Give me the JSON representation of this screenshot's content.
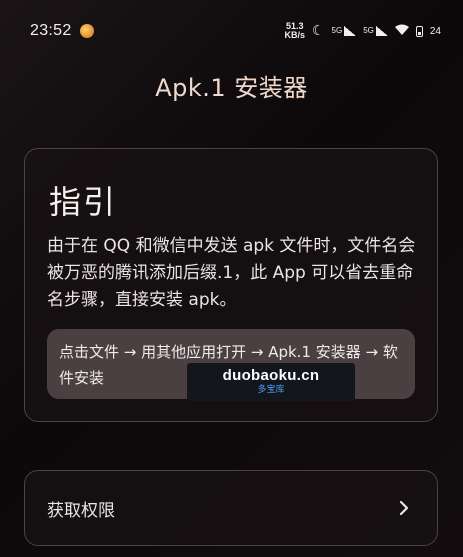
{
  "status_bar": {
    "time": "23:52",
    "net_speed_value": "51.3",
    "net_speed_unit": "KB/s",
    "signal1_tag": "5G",
    "signal2_tag": "5G",
    "battery": "24"
  },
  "header": {
    "title": "Apk.1 安装器"
  },
  "guide": {
    "title": "指引",
    "description": "由于在 QQ 和微信中发送 apk 文件时，文件名会被万恶的腾讯添加后缀.1，此 App 可以省去重命名步骤，直接安装 apk。",
    "steps": "点击文件 → 用其他应用打开 → Apk.1 安装器 → 软件安装"
  },
  "watermark": {
    "domain": "duobaoku.cn",
    "name": "多宝库"
  },
  "permission": {
    "label": "获取权限"
  }
}
